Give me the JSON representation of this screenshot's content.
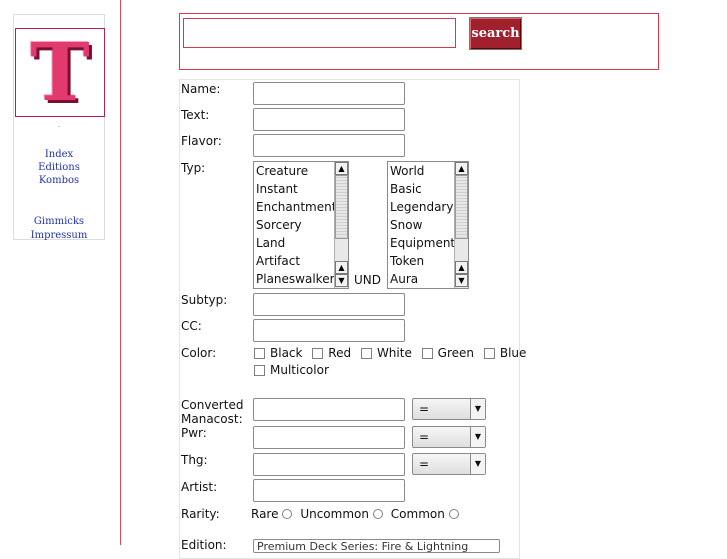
{
  "sidebar": {
    "logo_letter": "T",
    "dot": ".",
    "links": [
      "Index",
      "Editions",
      "Kombos"
    ],
    "links2": [
      "Gimmicks",
      "Impressum"
    ]
  },
  "search": {
    "value": "",
    "button_label": "search"
  },
  "form": {
    "name_label": "Name:",
    "text_label": "Text:",
    "flavor_label": "Flavor:",
    "typ_label": "Typ:",
    "typ_options": [
      "Creature",
      "Instant",
      "Enchantment",
      "Sorcery",
      "Land",
      "Artifact",
      "Planeswalker"
    ],
    "und_label": "UND",
    "supertyp_options": [
      "World",
      "Basic",
      "Legendary",
      "Snow",
      "Equipment",
      "Token",
      "Aura"
    ],
    "subtyp_label": "Subtyp:",
    "cc_label": "CC:",
    "color_label": "Color:",
    "colors": [
      "Black",
      "Red",
      "White",
      "Green",
      "Blue"
    ],
    "multicolor": "Multicolor",
    "cmc_label": "Converted Manacost:",
    "pwr_label": "Pwr:",
    "thg_label": "Thg:",
    "operator": "=",
    "artist_label": "Artist:",
    "rarity_label": "Rarity:",
    "rarities": [
      "Rare",
      "Uncommon",
      "Common"
    ],
    "edition_label": "Edition:",
    "edition_value": "Premium Deck Series: Fire & Lightning"
  },
  "colors": {
    "accent": "#d23a4a",
    "button": "#a0202e",
    "logo": "#e23a6f",
    "link": "#2233aa"
  }
}
